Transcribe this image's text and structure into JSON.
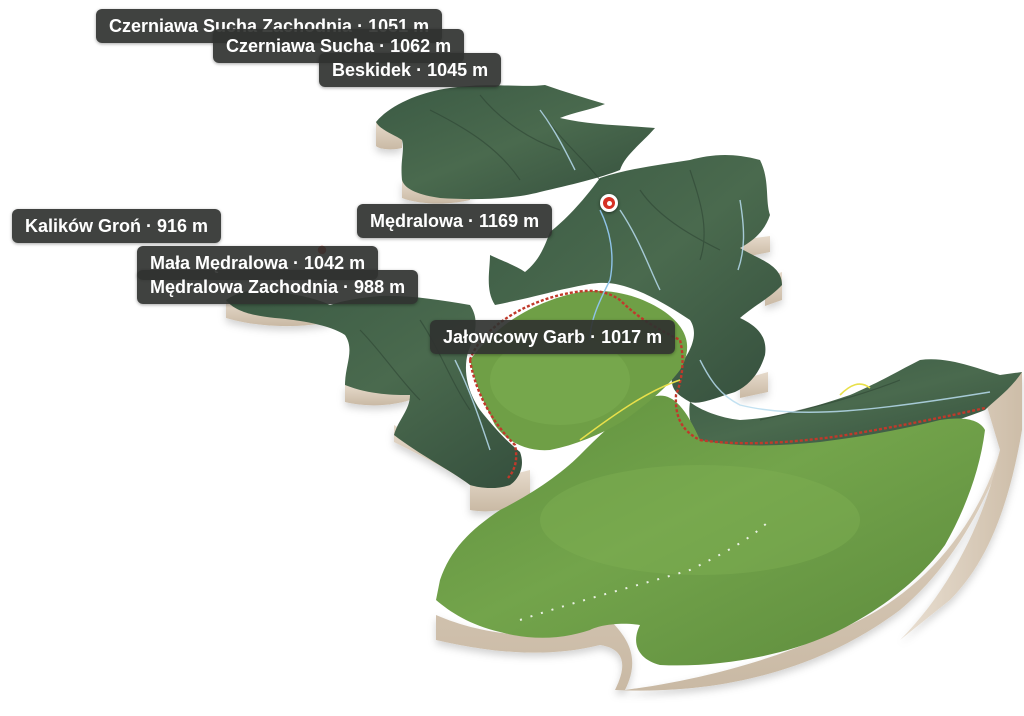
{
  "map": {
    "view": "3d-terrain",
    "colors": {
      "forest_dark": "#3d5a45",
      "forest_mid": "#4f6f52",
      "meadow": "#6b9a45",
      "meadow_light": "#7fae52",
      "base_side": "#ddd0bf",
      "base_shadow": "#b9aa96",
      "boundary": "#c0392b",
      "trail_yellow": "#e8e04a",
      "stream": "#a9d4ea",
      "marker": "#d63024",
      "label_bg": "#303230",
      "label_text": "#ffffff"
    }
  },
  "peaks": [
    {
      "name": "Czerniawa Sucha Zachodnia",
      "elevation": "1051 m"
    },
    {
      "name": "Czerniawa Sucha",
      "elevation": "1062 m"
    },
    {
      "name": "Beskidek",
      "elevation": "1045 m"
    },
    {
      "name": "Mędralowa",
      "elevation": "1169 m"
    },
    {
      "name": "Kalików Groń",
      "elevation": "916 m"
    },
    {
      "name": "Mała Mędralowa",
      "elevation": "1042 m"
    },
    {
      "name": "Mędralowa Zachodnia",
      "elevation": "988 m"
    },
    {
      "name": "Jałowcowy Garb",
      "elevation": "1017 m"
    }
  ],
  "separator": "·",
  "marker": {
    "icon": "location-pin-icon"
  }
}
